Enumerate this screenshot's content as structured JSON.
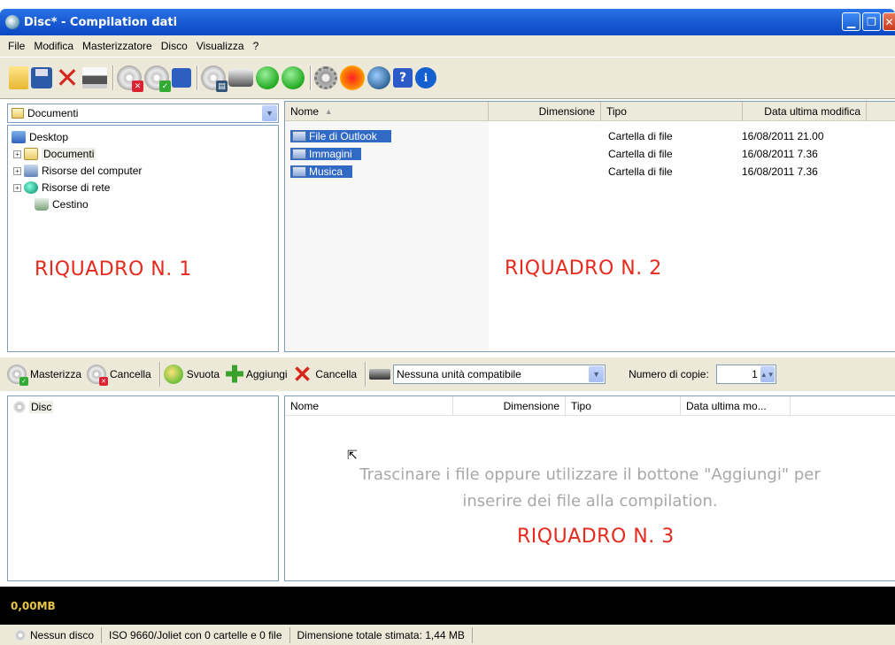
{
  "window": {
    "title": "Disc* - Compilation dati"
  },
  "menu": [
    "File",
    "Modifica",
    "Masterizzatore",
    "Disco",
    "Visualizza",
    "?"
  ],
  "toolbar": {
    "icons": [
      "new-folder-icon",
      "save-icon",
      "delete-icon",
      "print-icon",
      "cd-erase-icon",
      "cd-burn-icon",
      "blue-square-icon",
      "cd-image-icon",
      "drive-info-icon",
      "globe-green-icon",
      "globe-update-icon",
      "settings-gear-icon",
      "nero-icon",
      "web-icon",
      "help-icon",
      "info-icon"
    ]
  },
  "pane1": {
    "location": "Documenti",
    "tree": [
      "Desktop",
      "Documenti",
      "Risorse del computer",
      "Risorse di rete",
      "Cestino"
    ],
    "label": "RIQUADRO N. 1"
  },
  "pane2": {
    "columns": [
      "Nome",
      "Dimensione",
      "Tipo",
      "Data ultima modifica"
    ],
    "rows": [
      {
        "name": "File di Outlook",
        "type": "Cartella di file",
        "date": "16/08/2011 21.00"
      },
      {
        "name": "Immagini",
        "type": "Cartella di file",
        "date": "16/08/2011 7.36"
      },
      {
        "name": "Musica",
        "type": "Cartella di file",
        "date": "16/08/2011 7.36"
      }
    ],
    "label": "RIQUADRO N. 2"
  },
  "compilation_toolbar": {
    "burn": "Masterizza",
    "erase": "Cancella",
    "empty": "Svuota",
    "add": "Aggiungi",
    "delete": "Cancella",
    "drive": "Nessuna unità compatibile",
    "copies_label": "Numero di copie:",
    "copies": "1"
  },
  "pane3": {
    "disc": "Disc",
    "columns": [
      "Nome",
      "Dimensione",
      "Tipo",
      "Data ultima mo..."
    ],
    "hint_line1": "Trascinare i file oppure utilizzare il bottone \"Aggiungi\" per",
    "hint_line2": "inserire dei file alla compilation.",
    "label": "RIQUADRO N. 3"
  },
  "capacity": {
    "used": "0,00MB"
  },
  "status": {
    "disc": "Nessun disco",
    "format": "ISO 9660/Joliet con 0 cartelle e 0 file",
    "size": "Dimensione totale stimata: 1,44 MB"
  }
}
